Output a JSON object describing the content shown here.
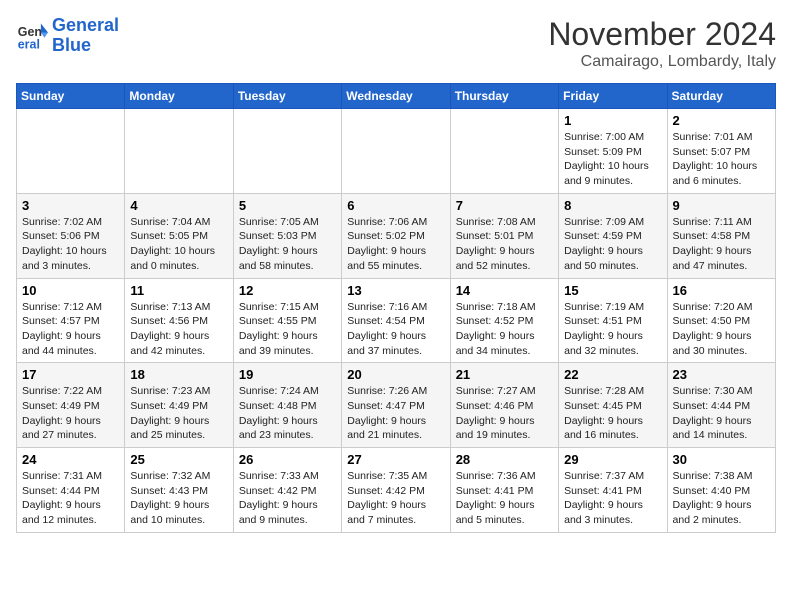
{
  "header": {
    "logo_line1": "General",
    "logo_line2": "Blue",
    "month": "November 2024",
    "location": "Camairago, Lombardy, Italy"
  },
  "weekdays": [
    "Sunday",
    "Monday",
    "Tuesday",
    "Wednesday",
    "Thursday",
    "Friday",
    "Saturday"
  ],
  "weeks": [
    [
      {
        "day": "",
        "info": ""
      },
      {
        "day": "",
        "info": ""
      },
      {
        "day": "",
        "info": ""
      },
      {
        "day": "",
        "info": ""
      },
      {
        "day": "",
        "info": ""
      },
      {
        "day": "1",
        "info": "Sunrise: 7:00 AM\nSunset: 5:09 PM\nDaylight: 10 hours\nand 9 minutes."
      },
      {
        "day": "2",
        "info": "Sunrise: 7:01 AM\nSunset: 5:07 PM\nDaylight: 10 hours\nand 6 minutes."
      }
    ],
    [
      {
        "day": "3",
        "info": "Sunrise: 7:02 AM\nSunset: 5:06 PM\nDaylight: 10 hours\nand 3 minutes."
      },
      {
        "day": "4",
        "info": "Sunrise: 7:04 AM\nSunset: 5:05 PM\nDaylight: 10 hours\nand 0 minutes."
      },
      {
        "day": "5",
        "info": "Sunrise: 7:05 AM\nSunset: 5:03 PM\nDaylight: 9 hours\nand 58 minutes."
      },
      {
        "day": "6",
        "info": "Sunrise: 7:06 AM\nSunset: 5:02 PM\nDaylight: 9 hours\nand 55 minutes."
      },
      {
        "day": "7",
        "info": "Sunrise: 7:08 AM\nSunset: 5:01 PM\nDaylight: 9 hours\nand 52 minutes."
      },
      {
        "day": "8",
        "info": "Sunrise: 7:09 AM\nSunset: 4:59 PM\nDaylight: 9 hours\nand 50 minutes."
      },
      {
        "day": "9",
        "info": "Sunrise: 7:11 AM\nSunset: 4:58 PM\nDaylight: 9 hours\nand 47 minutes."
      }
    ],
    [
      {
        "day": "10",
        "info": "Sunrise: 7:12 AM\nSunset: 4:57 PM\nDaylight: 9 hours\nand 44 minutes."
      },
      {
        "day": "11",
        "info": "Sunrise: 7:13 AM\nSunset: 4:56 PM\nDaylight: 9 hours\nand 42 minutes."
      },
      {
        "day": "12",
        "info": "Sunrise: 7:15 AM\nSunset: 4:55 PM\nDaylight: 9 hours\nand 39 minutes."
      },
      {
        "day": "13",
        "info": "Sunrise: 7:16 AM\nSunset: 4:54 PM\nDaylight: 9 hours\nand 37 minutes."
      },
      {
        "day": "14",
        "info": "Sunrise: 7:18 AM\nSunset: 4:52 PM\nDaylight: 9 hours\nand 34 minutes."
      },
      {
        "day": "15",
        "info": "Sunrise: 7:19 AM\nSunset: 4:51 PM\nDaylight: 9 hours\nand 32 minutes."
      },
      {
        "day": "16",
        "info": "Sunrise: 7:20 AM\nSunset: 4:50 PM\nDaylight: 9 hours\nand 30 minutes."
      }
    ],
    [
      {
        "day": "17",
        "info": "Sunrise: 7:22 AM\nSunset: 4:49 PM\nDaylight: 9 hours\nand 27 minutes."
      },
      {
        "day": "18",
        "info": "Sunrise: 7:23 AM\nSunset: 4:49 PM\nDaylight: 9 hours\nand 25 minutes."
      },
      {
        "day": "19",
        "info": "Sunrise: 7:24 AM\nSunset: 4:48 PM\nDaylight: 9 hours\nand 23 minutes."
      },
      {
        "day": "20",
        "info": "Sunrise: 7:26 AM\nSunset: 4:47 PM\nDaylight: 9 hours\nand 21 minutes."
      },
      {
        "day": "21",
        "info": "Sunrise: 7:27 AM\nSunset: 4:46 PM\nDaylight: 9 hours\nand 19 minutes."
      },
      {
        "day": "22",
        "info": "Sunrise: 7:28 AM\nSunset: 4:45 PM\nDaylight: 9 hours\nand 16 minutes."
      },
      {
        "day": "23",
        "info": "Sunrise: 7:30 AM\nSunset: 4:44 PM\nDaylight: 9 hours\nand 14 minutes."
      }
    ],
    [
      {
        "day": "24",
        "info": "Sunrise: 7:31 AM\nSunset: 4:44 PM\nDaylight: 9 hours\nand 12 minutes."
      },
      {
        "day": "25",
        "info": "Sunrise: 7:32 AM\nSunset: 4:43 PM\nDaylight: 9 hours\nand 10 minutes."
      },
      {
        "day": "26",
        "info": "Sunrise: 7:33 AM\nSunset: 4:42 PM\nDaylight: 9 hours\nand 9 minutes."
      },
      {
        "day": "27",
        "info": "Sunrise: 7:35 AM\nSunset: 4:42 PM\nDaylight: 9 hours\nand 7 minutes."
      },
      {
        "day": "28",
        "info": "Sunrise: 7:36 AM\nSunset: 4:41 PM\nDaylight: 9 hours\nand 5 minutes."
      },
      {
        "day": "29",
        "info": "Sunrise: 7:37 AM\nSunset: 4:41 PM\nDaylight: 9 hours\nand 3 minutes."
      },
      {
        "day": "30",
        "info": "Sunrise: 7:38 AM\nSunset: 4:40 PM\nDaylight: 9 hours\nand 2 minutes."
      }
    ]
  ]
}
